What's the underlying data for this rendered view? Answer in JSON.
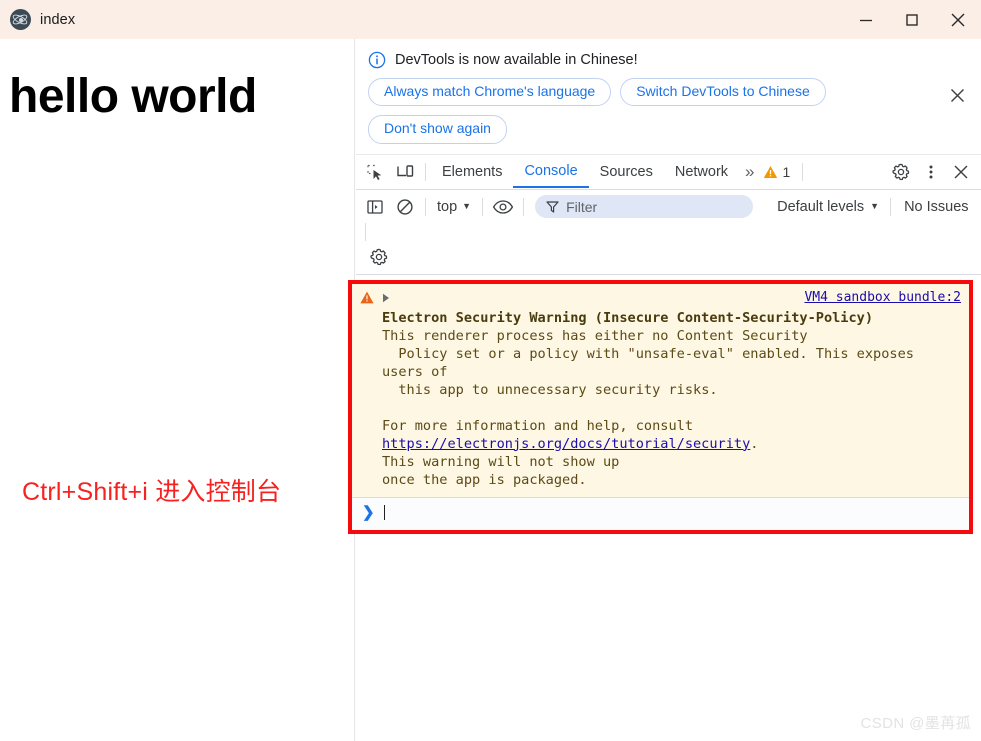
{
  "titlebar": {
    "app_icon": "electron-atom-icon",
    "title": "index",
    "minimize_label": "minimize-icon",
    "maximize_label": "maximize-icon",
    "close_label": "close-icon"
  },
  "page": {
    "heading": "hello world",
    "annotation": "Ctrl+Shift+i 进入控制台",
    "annotation_color": "#f5221f"
  },
  "devtools": {
    "infobar": {
      "icon": "info-circle-icon",
      "message": "DevTools is now available in Chinese!",
      "buttons": [
        "Always match Chrome's language",
        "Switch DevTools to Chinese",
        "Don't show again"
      ],
      "close_icon": "close-icon"
    },
    "tabbar": {
      "inspect_icon": "inspect-element-icon",
      "device_icon": "device-toolbar-icon",
      "tabs": [
        {
          "label": "Elements",
          "active": false
        },
        {
          "label": "Console",
          "active": true
        },
        {
          "label": "Sources",
          "active": false
        },
        {
          "label": "Network",
          "active": false
        }
      ],
      "more_tabs": "»",
      "warning_icon": "warning-triangle-icon",
      "warning_count": "1",
      "settings_icon": "gear-icon",
      "menu_icon": "more-vertical-icon",
      "close_icon": "close-icon"
    },
    "console_toolbar": {
      "sidebar_icon": "console-sidebar-icon",
      "clear_icon": "clear-console-icon",
      "context": "top",
      "context_caret": "▼",
      "eye_icon": "live-expression-eye-icon",
      "filter_icon": "filter-funnel-icon",
      "filter_value": "",
      "filter_placeholder": "Filter",
      "levels": "Default levels",
      "levels_caret": "▼",
      "issues": "No Issues",
      "settings_icon": "gear-icon"
    },
    "console_message": {
      "level_icon": "warning-triangle-icon",
      "expand_icon": "expand-arrow-icon",
      "source": "VM4 sandbox bundle:2",
      "title": "Electron Security Warning (Insecure Content-Security-Policy)",
      "line1": "This renderer process has either no Content Security",
      "line2": "  Policy set or a policy with \"unsafe-eval\" enabled. This exposes",
      "line3": "users of",
      "line4": "  this app to unnecessary security risks.",
      "line5": "",
      "line6": "For more information and help, consult",
      "link": "https://electronjs.org/docs/tutorial/security",
      "link_suffix": ".",
      "line7": "This warning will not show up",
      "line8": "once the app is packaged."
    },
    "prompt": {
      "chevron": "❯",
      "value": ""
    },
    "annotation_box_color": "#f50b0b"
  },
  "watermark": "CSDN @墨苒孤"
}
